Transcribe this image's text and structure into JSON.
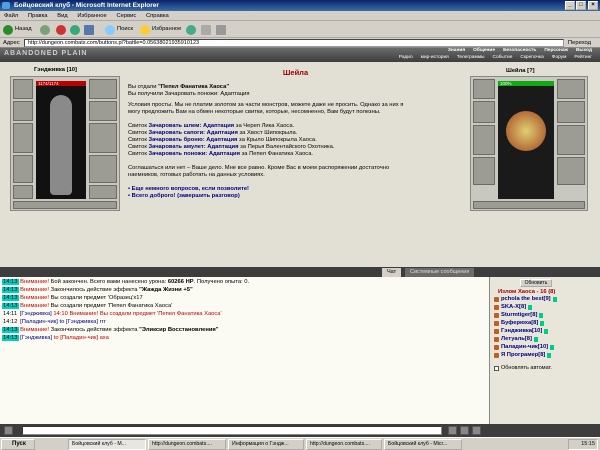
{
  "window": {
    "title": "Бойцовский клуб - Microsoft Internet Explorer"
  },
  "menu": [
    "Файл",
    "Правка",
    "Вид",
    "Избранное",
    "Сервис",
    "Справка"
  ],
  "toolbar": {
    "back": "Назад",
    "search": "Поиск",
    "favorites": "Избранное"
  },
  "address": {
    "label": "Адрес",
    "url": "http://dungeon.combats.com/buttons.pl?battle=0.05638021935910123",
    "go": "Переход"
  },
  "game": {
    "logo": "ABANDONED PLAIN",
    "nav_top": [
      "Знания",
      "Общение",
      "Безопасность",
      "Персонаж",
      "Выход"
    ],
    "nav_bottom": [
      "Радио",
      "мир-история",
      "Телеграммы",
      "Событие",
      "Скрепочка",
      "Форум",
      "Рейтинг"
    ]
  },
  "player": {
    "name": "Гэндживка",
    "level": "[10]",
    "hp": "1174/1174"
  },
  "npc": {
    "name": "Шейла",
    "level": "[?]",
    "hp": "100%"
  },
  "dialog": {
    "title": "Шейла",
    "gave_prefix": "Вы отдали",
    "gave_item": "\"Пепел Фанатика Хаоса\"",
    "received": "Вы получили Зачаровать поножи: Адаптация",
    "intro1": "Условия просты. Мы не платим золотом за части монстров, можете даже не просить. Однако за них я",
    "intro2": "могу предложить Вам на обмен некоторые свитки, которые, несомненно, Вам будут полезны.",
    "offers": [
      {
        "prefix": "Свиток",
        "name": "Зачаровать шлем: Адаптация",
        "suffix": "за Череп Лика Хаоса."
      },
      {
        "prefix": "Свиток",
        "name": "Зачаровать сапоги: Адаптация",
        "suffix": "за Хвост Шипокрыла."
      },
      {
        "prefix": "Свиток",
        "name": "Зачаровать броню: Адаптация",
        "suffix": "за Крыло Шипокрыла Хаоса."
      },
      {
        "prefix": "Свиток",
        "name": "Зачаровать амулет: Адаптация",
        "suffix": "за Перья Валентайского Охотника."
      },
      {
        "prefix": "Свиток",
        "name": "Зачаровать поножи: Адаптация",
        "suffix": "за Пепел Фанатика Хаоса."
      }
    ],
    "outro1": "Соглашаться или нет – Ваше дело. Мне все равно. Кроме Вас в моем распоряжении достаточно",
    "outro2": "наемников, готовых работать на данных условиях.",
    "choices": [
      "• Еще немного вопросов, если позволите!",
      "• Всего доброго! (завершить разговор)"
    ]
  },
  "chat": {
    "tab_chat": "Чат",
    "tab_system": "Системные сообщения",
    "lines": [
      {
        "time": "14:13",
        "warn": "Внимание!",
        "text": "Бой закончен. Всего вами нанесено урона:",
        "bold": "60266 HP",
        "tail": ". Получено опыта: 0."
      },
      {
        "time": "14:13",
        "warn": "Внимание!",
        "text": "Закончилось действие эффекта",
        "bold": "\"Жажда Жизни +5\"",
        "tail": ""
      },
      {
        "time": "14:13",
        "warn": "Внимание!",
        "text": "Вы создали предмет 'Образец'x17",
        "bold": "",
        "tail": ""
      },
      {
        "time": "14:13",
        "warn": "Внимание!",
        "text": "Вы создали предмет 'Пепел Фанатика Хаоса'",
        "bold": "",
        "tail": ""
      },
      {
        "time": "14:11",
        "nick": "[Гэндживка]",
        "text": "14:10 Внимание! Вы создали предмет 'Пепел Фанатика Хаоса'",
        "bold": "",
        "tail": ""
      },
      {
        "time": "14:12",
        "nick": "[Паладин-чик]",
        "text": "to [Гэндживка] ггг",
        "bold": "",
        "tail": ""
      },
      {
        "time": "14:13",
        "warn": "Внимание!",
        "text": "Закончилось действие эффекта",
        "bold": "\"Эликсир Восстановления\"",
        "tail": ""
      },
      {
        "time": "14:13",
        "nick": "[Гэндживка]",
        "text": "to [Паладин-чик] аха",
        "bold": "",
        "tail": ""
      }
    ]
  },
  "users": {
    "refresh": "Обновить",
    "room": "Излом Хаоса - 16 (8)",
    "list": [
      "pchola the best[9]",
      "SKA-X[8]",
      "Sturmtiger[8]",
      "Буферюха[8]",
      "Гэндживка[10]",
      "Летуаль[8]",
      "Паладин-чик[10]",
      "Я Програмер[8]"
    ],
    "auto": "Обновлять автомат."
  },
  "taskbar": {
    "start": "Пуск",
    "tasks": [
      "Бойцовский клуб - M...",
      "http://dungeon.combats....",
      "Информация о Гэндж...",
      "http://dungeon.combats....",
      "Бойцовский клуб - Micr..."
    ],
    "time": "15:15"
  }
}
